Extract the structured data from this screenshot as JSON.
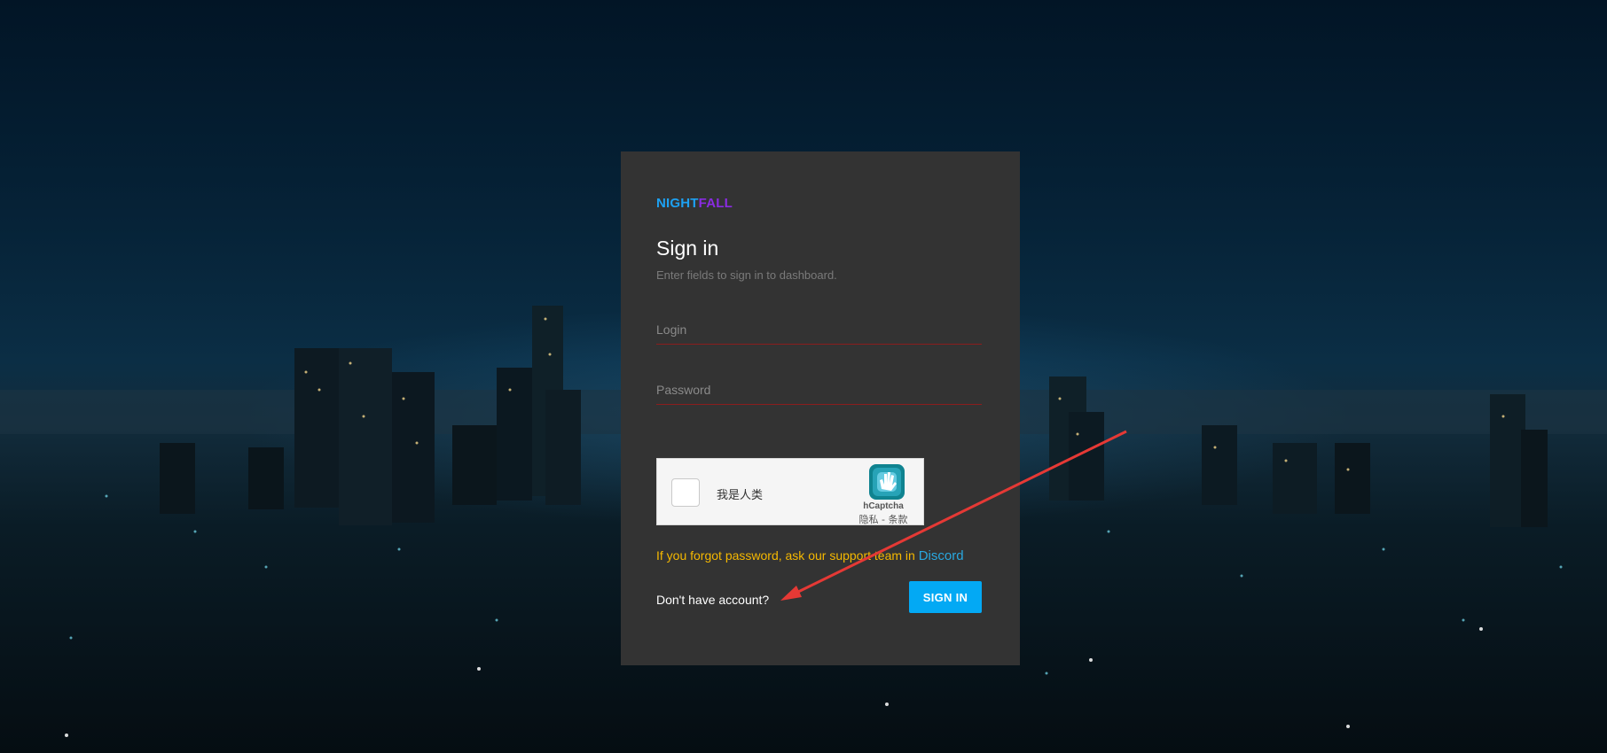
{
  "brand": {
    "part1": "NIGHT",
    "part2": "FALL",
    "color1": "#1da1f2",
    "color2": "#8a2be2"
  },
  "form": {
    "title": "Sign in",
    "subtitle": "Enter fields to sign in to dashboard.",
    "login_placeholder": "Login",
    "password_placeholder": "Password"
  },
  "captcha": {
    "label": "我是人类",
    "brand": "hCaptcha",
    "terms": "隐私 - 条款",
    "icon": "hcaptcha-hand-icon"
  },
  "help": {
    "forgot_text": "If you forgot password, ask our support team in",
    "discord_link": "Discord",
    "forgot_color": "#f5b800",
    "link_color": "#29a8e0"
  },
  "footer": {
    "no_account": "Don't have account?",
    "signin_button": "SIGN IN",
    "button_color": "#03a9f4"
  },
  "annotation": {
    "icon": "red-arrow-icon",
    "color": "#e53935"
  }
}
